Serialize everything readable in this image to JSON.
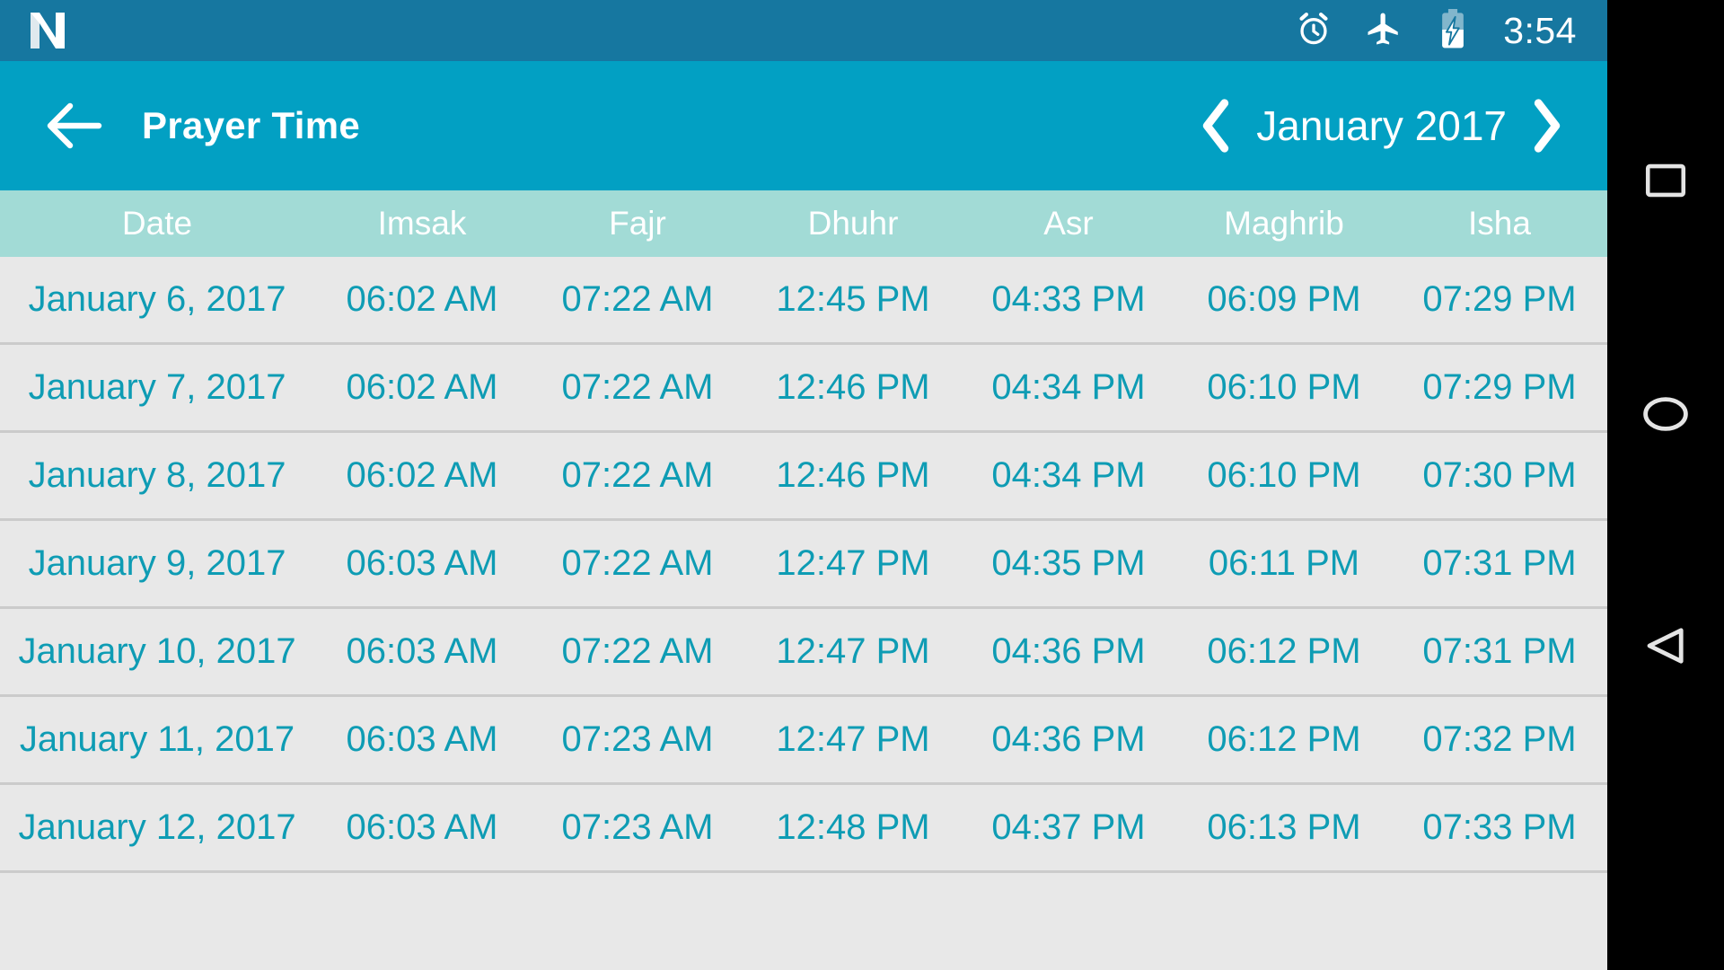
{
  "status_bar": {
    "logo_icon": "android-n-logo-icon",
    "icons": [
      "alarm-clock-icon",
      "airplane-mode-icon",
      "battery-charging-icon"
    ],
    "clock": "3:54",
    "background_color": "#1677a0"
  },
  "app_bar": {
    "back_icon": "back-arrow-icon",
    "title": "Prayer Time",
    "prev_icon": "chevron-left-icon",
    "month_label": "January 2017",
    "next_icon": "chevron-right-icon",
    "background_color": "#02a0c3"
  },
  "table": {
    "header_background": "#a2dbd6",
    "row_background": "#e8e8e8",
    "text_color": "#0e9cb4",
    "columns": [
      "Date",
      "Imsak",
      "Fajr",
      "Dhuhr",
      "Asr",
      "Maghrib",
      "Isha"
    ],
    "rows": [
      {
        "date": "January 6, 2017",
        "imsak": "06:02 AM",
        "fajr": "07:22 AM",
        "dhuhr": "12:45 PM",
        "asr": "04:33 PM",
        "maghrib": "06:09 PM",
        "isha": "07:29 PM"
      },
      {
        "date": "January 7, 2017",
        "imsak": "06:02 AM",
        "fajr": "07:22 AM",
        "dhuhr": "12:46 PM",
        "asr": "04:34 PM",
        "maghrib": "06:10 PM",
        "isha": "07:29 PM"
      },
      {
        "date": "January 8, 2017",
        "imsak": "06:02 AM",
        "fajr": "07:22 AM",
        "dhuhr": "12:46 PM",
        "asr": "04:34 PM",
        "maghrib": "06:10 PM",
        "isha": "07:30 PM"
      },
      {
        "date": "January 9, 2017",
        "imsak": "06:03 AM",
        "fajr": "07:22 AM",
        "dhuhr": "12:47 PM",
        "asr": "04:35 PM",
        "maghrib": "06:11 PM",
        "isha": "07:31 PM"
      },
      {
        "date": "January 10, 2017",
        "imsak": "06:03 AM",
        "fajr": "07:22 AM",
        "dhuhr": "12:47 PM",
        "asr": "04:36 PM",
        "maghrib": "06:12 PM",
        "isha": "07:31 PM"
      },
      {
        "date": "January 11, 2017",
        "imsak": "06:03 AM",
        "fajr": "07:23 AM",
        "dhuhr": "12:47 PM",
        "asr": "04:36 PM",
        "maghrib": "06:12 PM",
        "isha": "07:32 PM"
      },
      {
        "date": "January 12, 2017",
        "imsak": "06:03 AM",
        "fajr": "07:23 AM",
        "dhuhr": "12:48 PM",
        "asr": "04:37 PM",
        "maghrib": "06:13 PM",
        "isha": "07:33 PM"
      }
    ]
  },
  "nav_bar": {
    "recents_icon": "square-recents-icon",
    "home_icon": "circle-home-icon",
    "back_icon": "triangle-back-icon",
    "background_color": "#000000"
  }
}
